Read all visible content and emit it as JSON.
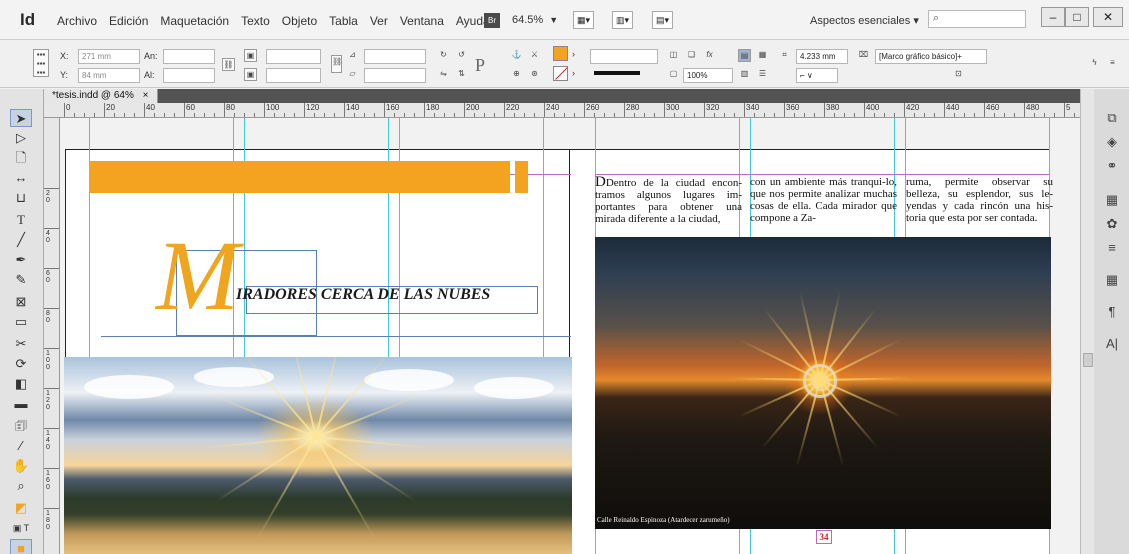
{
  "app": {
    "logo": "Id",
    "menu": [
      "Archivo",
      "Edición",
      "Maquetación",
      "Texto",
      "Objeto",
      "Tabla",
      "Ver",
      "Ventana",
      "Ayuda"
    ],
    "bridge": "Br",
    "zoom": "64.5%",
    "workspace": "Aspectos esenciales",
    "window_buttons": {
      "minimize": "–",
      "maximize": "□",
      "close": "✕"
    }
  },
  "control_panel": {
    "x_label": "X:",
    "x_value": "271 mm",
    "y_label": "Y:",
    "y_value": "84 mm",
    "w_label": "An:",
    "h_label": "Al:",
    "stroke_percent": "100%",
    "stroke_weight": "4.233 mm",
    "object_style": "[Marco gráfico básico]+"
  },
  "document": {
    "tab_title": "*tesis.indd @ 64%",
    "tab_close": "×",
    "ruler_marks": [
      "0",
      "20",
      "40",
      "60",
      "80",
      "100",
      "120",
      "140",
      "160",
      "180",
      "200",
      "220",
      "240",
      "260",
      "280",
      "300",
      "320",
      "340",
      "360",
      "380",
      "400",
      "420",
      "440",
      "460",
      "480",
      "5"
    ],
    "vruler_marks": [
      "2",
      "4",
      "6",
      "8",
      "10",
      "12",
      "14",
      "16",
      "18"
    ]
  },
  "layout": {
    "big_initial": "M",
    "title_rest": "IRADORES CERCA DE LAS NUBES",
    "columns": [
      "Dentro de la ciudad encon-tramos algunos lugares im-portantes para obtener una mirada diferente a la ciudad,",
      "con un ambiente más tranqui-lo, que nos permite analizar muchas cosas de ella. Cada mirador que compone a Za-",
      "ruma, permite observar su belleza, su esplendor, sus le-yendas y cada rincón una his-toria que esta por ser contada."
    ],
    "photo_caption": "Calle Reinaldo Espinoza (Atardecer zarumeño)",
    "page_number": "34"
  },
  "colors": {
    "accent_orange": "#f4a320",
    "guide_cyan": "#44c9d6",
    "margin_purple": "#b56bc7"
  },
  "icons": {
    "tools": [
      "selection-icon",
      "direct-selection-icon",
      "page-tool-icon",
      "gap-tool-icon",
      "content-collector-icon",
      "type-tool-icon",
      "line-tool-icon",
      "pen-tool-icon",
      "pencil-tool-icon",
      "rectangle-frame-icon",
      "rectangle-tool-icon",
      "scissors-icon",
      "free-transform-icon",
      "gradient-swatch-icon",
      "gradient-feather-icon",
      "note-tool-icon",
      "eyedropper-icon",
      "hand-tool-icon",
      "zoom-tool-icon",
      "fill-stroke-icon",
      "swap-icon",
      "format-text-icon",
      "normal-view-icon",
      "screen-mode-icon"
    ],
    "panels": [
      "pages-panel-icon",
      "layers-panel-icon",
      "links-panel-icon",
      "swatches-panel-icon",
      "color-panel-icon",
      "stroke-panel-icon",
      "table-panel-icon",
      "paragraph-panel-icon",
      "character-panel-icon"
    ]
  }
}
